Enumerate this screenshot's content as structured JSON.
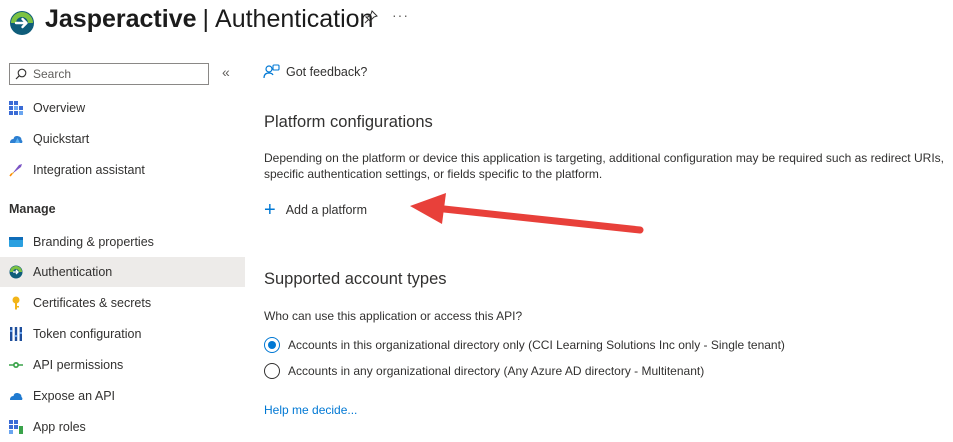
{
  "header": {
    "app_name": "Jasperactive",
    "separator": "|",
    "page_name": "Authentication",
    "more": "···"
  },
  "sidebar": {
    "search_placeholder": "Search",
    "collapse": "«",
    "items": [
      {
        "label": "Overview",
        "icon": "overview-icon"
      },
      {
        "label": "Quickstart",
        "icon": "quickstart-icon"
      },
      {
        "label": "Integration assistant",
        "icon": "rocket-icon"
      }
    ],
    "manage_header": "Manage",
    "manage_items": [
      {
        "label": "Branding & properties",
        "icon": "branding-icon"
      },
      {
        "label": "Authentication",
        "icon": "authentication-icon",
        "selected": true
      },
      {
        "label": "Certificates & secrets",
        "icon": "key-icon"
      },
      {
        "label": "Token configuration",
        "icon": "token-icon"
      },
      {
        "label": "API permissions",
        "icon": "api-permissions-icon"
      },
      {
        "label": "Expose an API",
        "icon": "cloud-icon"
      },
      {
        "label": "App roles",
        "icon": "app-roles-icon"
      }
    ]
  },
  "main": {
    "feedback_label": "Got feedback?",
    "platform_title": "Platform configurations",
    "platform_desc": "Depending on the platform or device this application is targeting, additional configuration may be required such as redirect URIs, specific authentication settings, or fields specific to the platform.",
    "add_platform": "Add a platform",
    "add_platform_plus": "+",
    "account_title": "Supported account types",
    "account_question": "Who can use this application or access this API?",
    "options": [
      {
        "label": "Accounts in this organizational directory only (CCI Learning Solutions Inc only - Single tenant)",
        "selected": true
      },
      {
        "label": "Accounts in any organizational directory (Any Azure AD directory - Multitenant)",
        "selected": false
      }
    ],
    "help_link": "Help me decide..."
  },
  "colors": {
    "accent": "#0078d4",
    "selected_bg": "#edebe9",
    "annotation_arrow": "#e8403a"
  }
}
